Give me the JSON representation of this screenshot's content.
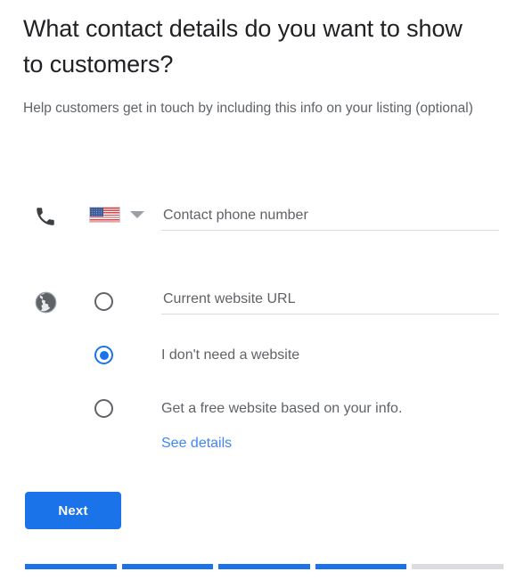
{
  "page": {
    "heading": "What contact details do you want to show to customers?",
    "subtitle": "Help customers get in touch by including this info on your listing (optional)"
  },
  "phone": {
    "icon": "phone-icon",
    "country_flag": "us-flag-icon",
    "country_caret": "chevron-down-icon",
    "placeholder": "Contact phone number",
    "value": ""
  },
  "website": {
    "icon": "globe-icon",
    "options": [
      {
        "id": "current-website",
        "type": "input",
        "selected": false,
        "placeholder": "Current website URL",
        "value": ""
      },
      {
        "id": "no-website",
        "type": "label",
        "selected": true,
        "label": "I don't need a website"
      },
      {
        "id": "free-website",
        "type": "label",
        "selected": false,
        "label": "Get a free website based on your info.",
        "link": "See details"
      }
    ]
  },
  "actions": {
    "next_label": "Next"
  },
  "progress": {
    "total_steps": 5,
    "completed_steps": 4
  },
  "colors": {
    "accent": "#1a73e8",
    "link": "#4285f4",
    "text_primary": "#202124",
    "text_secondary": "#5f6368",
    "divider": "#dadce0"
  }
}
